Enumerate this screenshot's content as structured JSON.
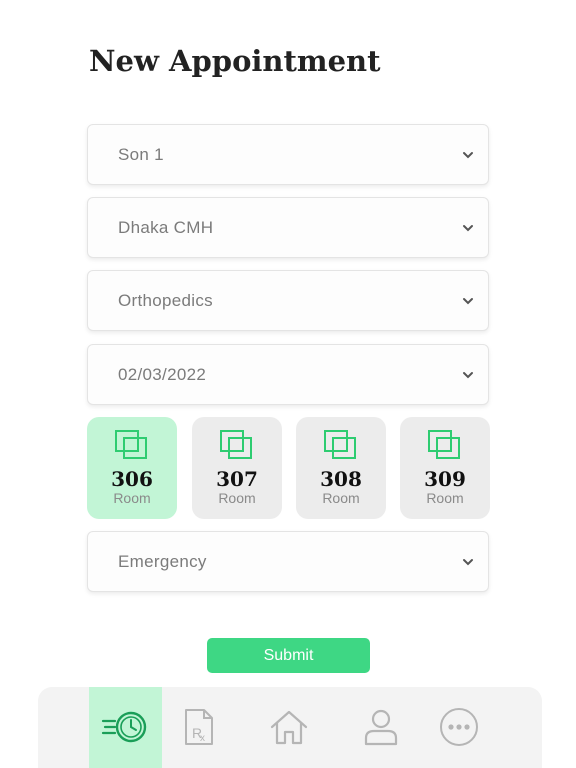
{
  "page": {
    "title": "New Appointment"
  },
  "form": {
    "patient": "Son 1",
    "hospital": "Dhaka CMH",
    "department": "Orthopedics",
    "date": "02/03/2022",
    "type": "Emergency"
  },
  "rooms": [
    {
      "number": "306",
      "label": "Room",
      "selected": true
    },
    {
      "number": "307",
      "label": "Room",
      "selected": false
    },
    {
      "number": "308",
      "label": "Room",
      "selected": false
    },
    {
      "number": "309",
      "label": "Room",
      "selected": false
    }
  ],
  "submit_label": "Submit",
  "nav": [
    {
      "icon": "fast-clock-icon",
      "active": true
    },
    {
      "icon": "prescription-icon",
      "active": false
    },
    {
      "icon": "home-icon",
      "active": false
    },
    {
      "icon": "user-icon",
      "active": false
    },
    {
      "icon": "more-icon",
      "active": false
    }
  ],
  "colors": {
    "accent": "#3ed784",
    "accent_light": "#c2f5d6",
    "icon_green": "#2ecc71"
  }
}
